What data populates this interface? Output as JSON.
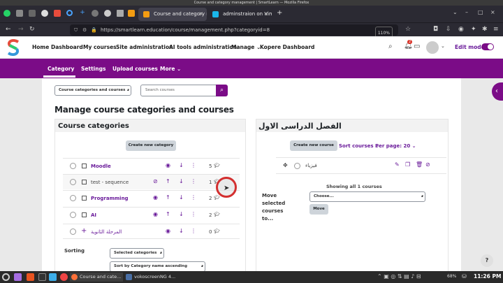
{
  "os": {
    "title": "Course and category management | SmartLearn — Mozilla Firefox"
  },
  "browser": {
    "tabs": [
      {
        "label": "Course and category n",
        "active": true
      },
      {
        "label": "adminstraion on Vim",
        "active": false
      }
    ],
    "new_tab": "+",
    "url": "https://smartlearn.education/course/management.php?categoryid=8",
    "zoom": "110%"
  },
  "header": {
    "nav": [
      "Home",
      "Dashboard",
      "My courses",
      "Site administration",
      "AI tools administration",
      "Manage ⌄",
      "Kopere Dashboard"
    ],
    "notification_count": "2",
    "edit_mode_label": "Edit mode",
    "edit_mode_on": true
  },
  "secondary_nav": {
    "items": [
      "Category",
      "Settings",
      "Upload courses",
      "More ⌄"
    ],
    "active": "Category"
  },
  "page": {
    "view_select": "Course categories and courses",
    "search_placeholder": "Search courses",
    "title": "Manage course categories and courses",
    "left": {
      "heading": "Course categories",
      "create_button": "Create new category",
      "rows": [
        {
          "name": "Moodle",
          "count": "5"
        },
        {
          "name": "test - sequence",
          "count": "1"
        },
        {
          "name": "Programming",
          "count": "2"
        },
        {
          "name": "AI",
          "count": "2"
        },
        {
          "name": "المرحلة الثانوية",
          "count": "0"
        }
      ],
      "sorting_label": "Sorting",
      "sorting_select": "Selected categories",
      "sort_by_select": "Sort by Category name ascending"
    },
    "right": {
      "heading": "الفصل الدراسى الاول",
      "create_button": "Create new course",
      "sort_courses": "Sort courses",
      "per_page": "Per page: 20",
      "course_name": "فيزياء",
      "showing": "Showing all 1 courses",
      "move_label": "Move selected courses to...",
      "choose_select": "Choose...",
      "move_button": "Move"
    }
  },
  "help_button": "?",
  "taskbar": {
    "tasks": [
      "Course and cate...",
      "vokoscreenNG 4..."
    ],
    "battery": "68%",
    "clock": "11:26 PM"
  },
  "colors": {
    "brand": "#7b0c87",
    "link": "#6a1b9a",
    "browser_chrome": "#2b2a33"
  }
}
